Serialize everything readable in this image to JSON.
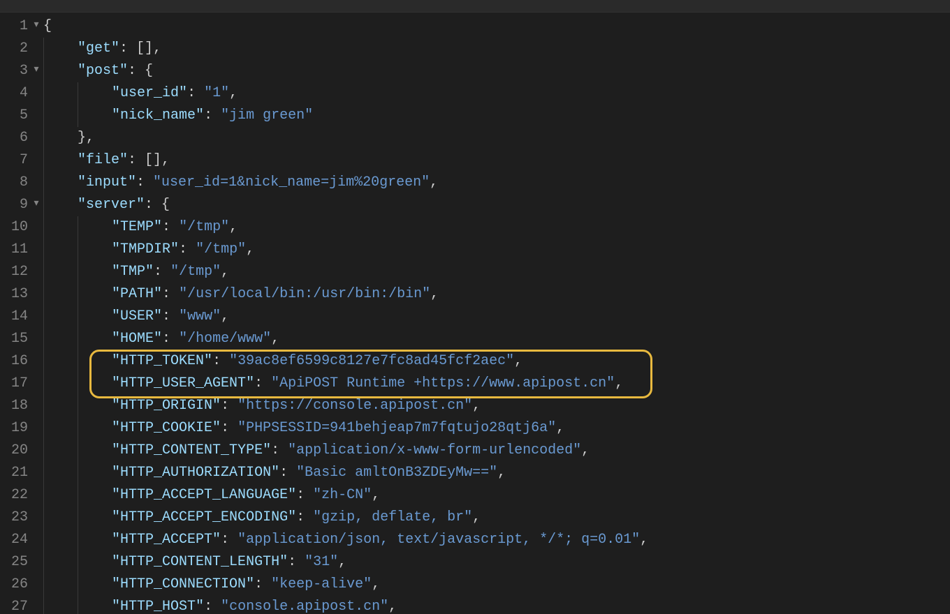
{
  "editor": {
    "lineNumbers": [
      "1",
      "2",
      "3",
      "4",
      "5",
      "6",
      "7",
      "8",
      "9",
      "10",
      "11",
      "12",
      "13",
      "14",
      "15",
      "16",
      "17",
      "18",
      "19",
      "20",
      "21",
      "22",
      "23",
      "24",
      "25",
      "26",
      "27"
    ],
    "foldable": {
      "1": true,
      "3": true,
      "9": true
    },
    "code": {
      "l1": {
        "open": "{"
      },
      "l2": {
        "key": "\"get\"",
        "colon": ": ",
        "val": "[]",
        "comma": ","
      },
      "l3": {
        "key": "\"post\"",
        "colon": ": ",
        "brace": "{"
      },
      "l4": {
        "key": "\"user_id\"",
        "colon": ": ",
        "val": "\"1\"",
        "comma": ","
      },
      "l5": {
        "key": "\"nick_name\"",
        "colon": ": ",
        "val": "\"jim green\""
      },
      "l6": {
        "close": "}",
        "comma": ","
      },
      "l7": {
        "key": "\"file\"",
        "colon": ": ",
        "val": "[]",
        "comma": ","
      },
      "l8": {
        "key": "\"input\"",
        "colon": ": ",
        "val": "\"user_id=1&nick_name=jim%20green\"",
        "comma": ","
      },
      "l9": {
        "key": "\"server\"",
        "colon": ": ",
        "brace": "{"
      },
      "l10": {
        "key": "\"TEMP\"",
        "colon": ": ",
        "val": "\"/tmp\"",
        "comma": ","
      },
      "l11": {
        "key": "\"TMPDIR\"",
        "colon": ": ",
        "val": "\"/tmp\"",
        "comma": ","
      },
      "l12": {
        "key": "\"TMP\"",
        "colon": ": ",
        "val": "\"/tmp\"",
        "comma": ","
      },
      "l13": {
        "key": "\"PATH\"",
        "colon": ": ",
        "val": "\"/usr/local/bin:/usr/bin:/bin\"",
        "comma": ","
      },
      "l14": {
        "key": "\"USER\"",
        "colon": ": ",
        "val": "\"www\"",
        "comma": ","
      },
      "l15": {
        "key": "\"HOME\"",
        "colon": ": ",
        "val": "\"/home/www\"",
        "comma": ","
      },
      "l16": {
        "key": "\"HTTP_TOKEN\"",
        "colon": ": ",
        "val": "\"39ac8ef6599c8127e7fc8ad45fcf2aec\"",
        "comma": ","
      },
      "l17": {
        "key": "\"HTTP_USER_AGENT\"",
        "colon": ": ",
        "val": "\"ApiPOST Runtime +https://www.apipost.cn\"",
        "comma": ","
      },
      "l18": {
        "key": "\"HTTP_ORIGIN\"",
        "colon": ": ",
        "val": "\"https://console.apipost.cn\"",
        "comma": ","
      },
      "l19": {
        "key": "\"HTTP_COOKIE\"",
        "colon": ": ",
        "val": "\"PHPSESSID=941behjeap7m7fqtujo28qtj6a\"",
        "comma": ","
      },
      "l20": {
        "key": "\"HTTP_CONTENT_TYPE\"",
        "colon": ": ",
        "val": "\"application/x-www-form-urlencoded\"",
        "comma": ","
      },
      "l21": {
        "key": "\"HTTP_AUTHORIZATION\"",
        "colon": ": ",
        "val": "\"Basic amltOnB3ZDEyMw==\"",
        "comma": ","
      },
      "l22": {
        "key": "\"HTTP_ACCEPT_LANGUAGE\"",
        "colon": ": ",
        "val": "\"zh-CN\"",
        "comma": ","
      },
      "l23": {
        "key": "\"HTTP_ACCEPT_ENCODING\"",
        "colon": ": ",
        "val": "\"gzip, deflate, br\"",
        "comma": ","
      },
      "l24": {
        "key": "\"HTTP_ACCEPT\"",
        "colon": ": ",
        "val": "\"application/json, text/javascript, */*; q=0.01\"",
        "comma": ","
      },
      "l25": {
        "key": "\"HTTP_CONTENT_LENGTH\"",
        "colon": ": ",
        "val": "\"31\"",
        "comma": ","
      },
      "l26": {
        "key": "\"HTTP_CONNECTION\"",
        "colon": ": ",
        "val": "\"keep-alive\"",
        "comma": ","
      },
      "l27": {
        "key": "\"HTTP_HOST\"",
        "colon": ": ",
        "val": "\"console.apipost.cn\"",
        "comma": ","
      }
    }
  },
  "highlight": {
    "targetLine": 16
  },
  "indentUnit": "    "
}
